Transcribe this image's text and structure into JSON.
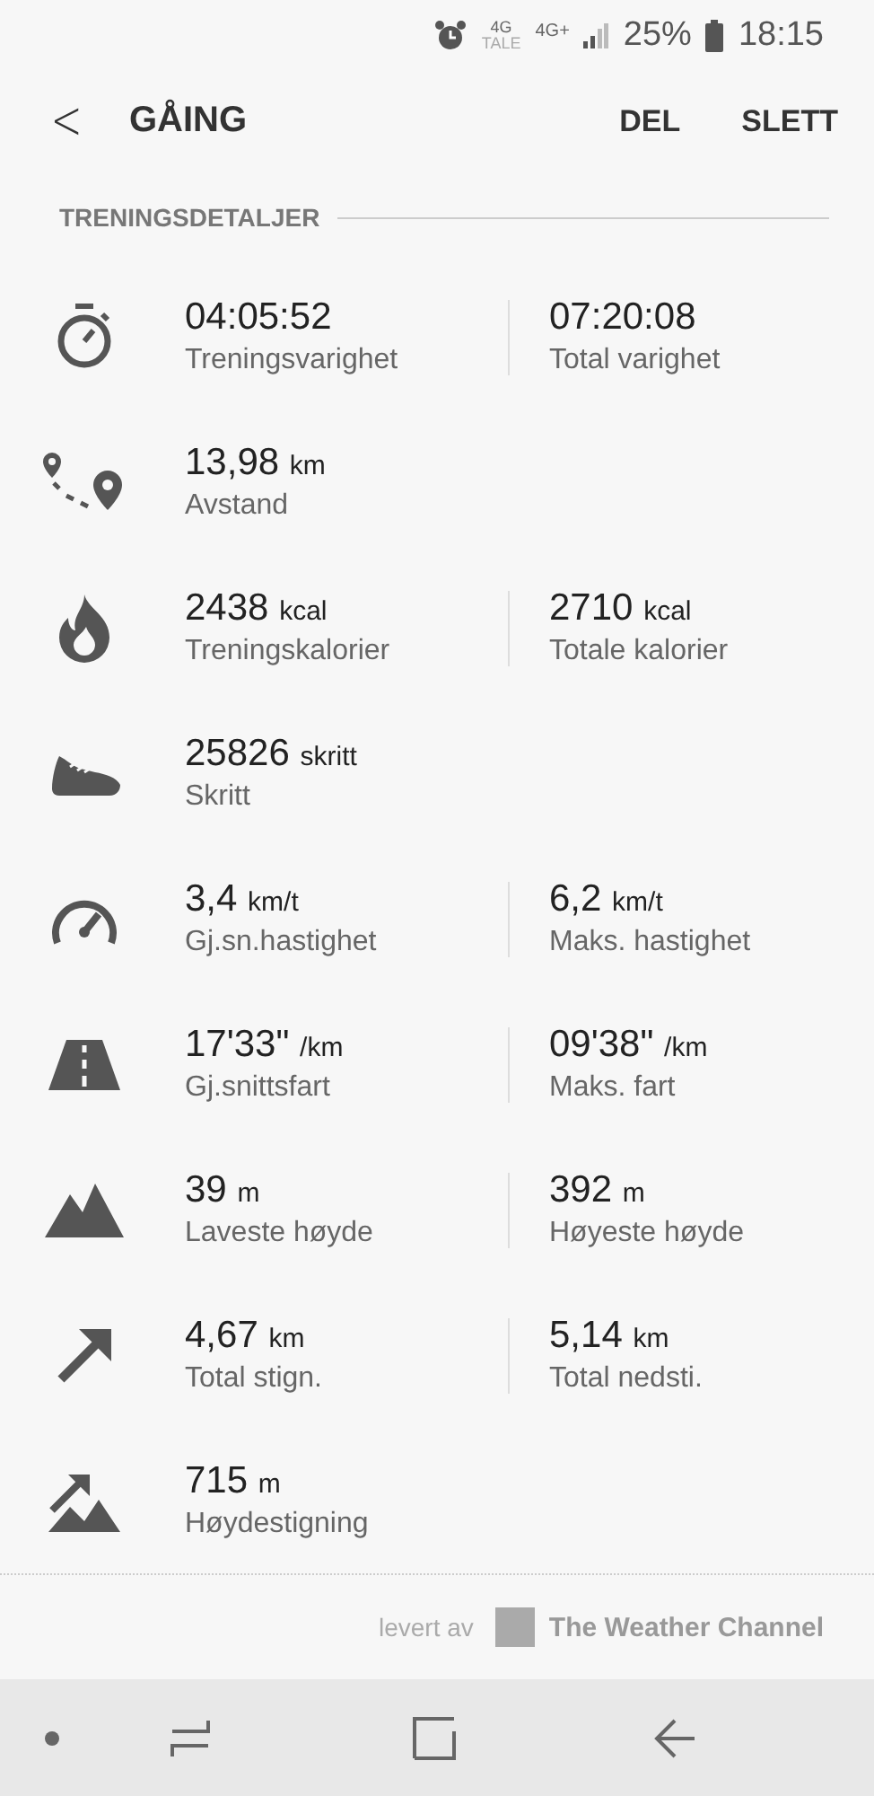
{
  "status_bar": {
    "network_1": "4G",
    "network_1_sub": "TALE",
    "network_2": "4G+",
    "battery": "25%",
    "time": "18:15"
  },
  "header": {
    "back": "<",
    "title": "GÅING",
    "actions": [
      "DEL",
      "SLETT"
    ]
  },
  "section_title": "TRENINGSDETALJER",
  "stats": [
    {
      "kind": "stopwatch",
      "items": [
        {
          "value": "04:05:52",
          "label": "Treningsvarighet"
        },
        {
          "value": "07:20:08",
          "label": "Total varighet"
        }
      ]
    },
    {
      "kind": "route",
      "items": [
        {
          "value": "13,98",
          "unit": "km",
          "label": "Avstand"
        }
      ]
    },
    {
      "kind": "flame",
      "items": [
        {
          "value": "2438",
          "unit": "kcal",
          "label": "Treningskalorier"
        },
        {
          "value": "2710",
          "unit": "kcal",
          "label": "Totale kalorier"
        }
      ]
    },
    {
      "kind": "shoe",
      "items": [
        {
          "value": "25826",
          "unit": "skritt",
          "label": "Skritt"
        }
      ]
    },
    {
      "kind": "speedometer",
      "items": [
        {
          "value": "3,4",
          "unit": "km/t",
          "label": "Gj.sn.hastighet"
        },
        {
          "value": "6,2",
          "unit": "km/t",
          "label": "Maks. hastighet"
        }
      ]
    },
    {
      "kind": "road",
      "items": [
        {
          "value": "17'33\"",
          "unit": "/km",
          "label": "Gj.snittsfart"
        },
        {
          "value": "09'38\"",
          "unit": "/km",
          "label": "Maks. fart"
        }
      ]
    },
    {
      "kind": "mountain",
      "items": [
        {
          "value": "39",
          "unit": "m",
          "label": "Laveste høyde"
        },
        {
          "value": "392",
          "unit": "m",
          "label": "Høyeste høyde"
        }
      ]
    },
    {
      "kind": "arrow",
      "items": [
        {
          "value": "4,67",
          "unit": "km",
          "label": "Total stign."
        },
        {
          "value": "5,14",
          "unit": "km",
          "label": "Total nedsti."
        }
      ]
    },
    {
      "kind": "climb",
      "items": [
        {
          "value": "715",
          "unit": "m",
          "label": "Høydestigning"
        }
      ]
    }
  ],
  "credit": {
    "prefix": "levert av",
    "brand": "The Weather Channel"
  }
}
